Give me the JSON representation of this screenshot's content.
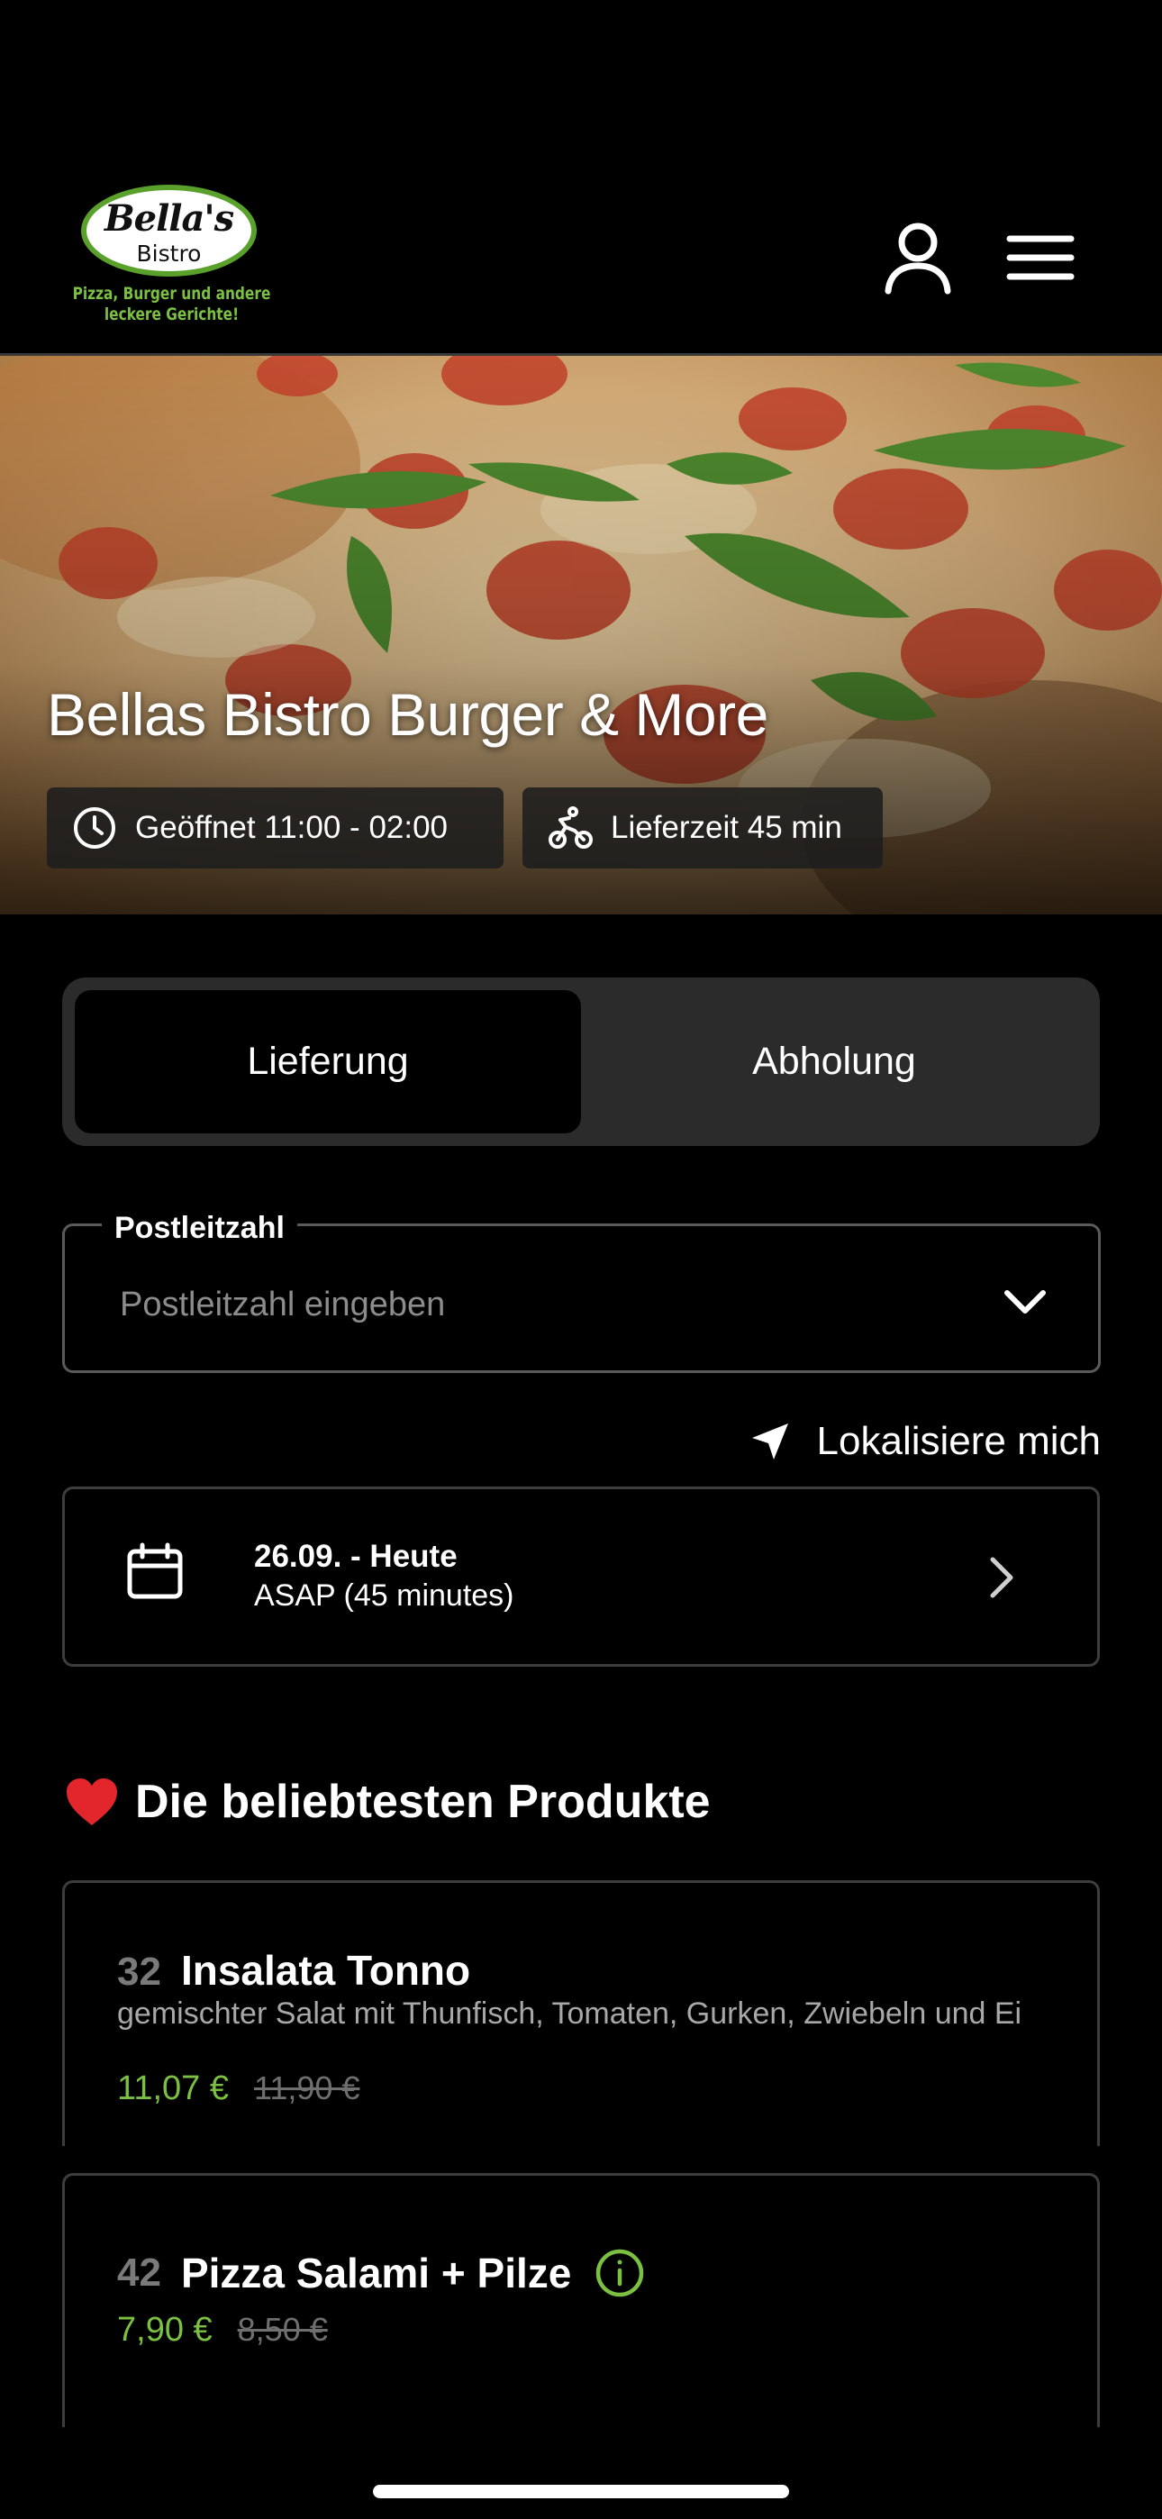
{
  "header": {
    "logo": {
      "script": "Bella's",
      "sub": "Bistro",
      "tagline_line1": "Pizza, Burger und andere",
      "tagline_line2": "leckere Gerichte!"
    },
    "user_icon": "user-icon",
    "menu_icon": "hamburger-menu-icon"
  },
  "hero": {
    "title": "Bellas Bistro Burger & More",
    "opening": "Geöffnet 11:00 - 02:00",
    "delivery_time": "Lieferzeit 45 min"
  },
  "toggle": {
    "delivery": "Lieferung",
    "pickup": "Abholung",
    "selected": "Lieferung"
  },
  "postal": {
    "label": "Postleitzahl",
    "placeholder": "Postleitzahl eingeben",
    "value": ""
  },
  "locate": {
    "label": "Lokalisiere mich"
  },
  "schedule": {
    "date": "26.09. - Heute",
    "time": "ASAP (45 minutes)"
  },
  "popular": {
    "title": "Die beliebtesten Produkte",
    "products": [
      {
        "number": "32",
        "name": "Insalata Tonno",
        "description": "gemischter Salat mit Thunfisch, Tomaten, Gurken, Zwiebeln und Ei",
        "price": "11,07 €",
        "old_price": "11,90 €"
      },
      {
        "number": "42",
        "name": "Pizza Salami + Pilze",
        "price": "7,90 €",
        "old_price": "8,50 €"
      }
    ]
  },
  "colors": {
    "accent": "#7bc043",
    "background": "#000000",
    "toggle_bg": "#2b2b2b",
    "heart": "#e3262b"
  }
}
